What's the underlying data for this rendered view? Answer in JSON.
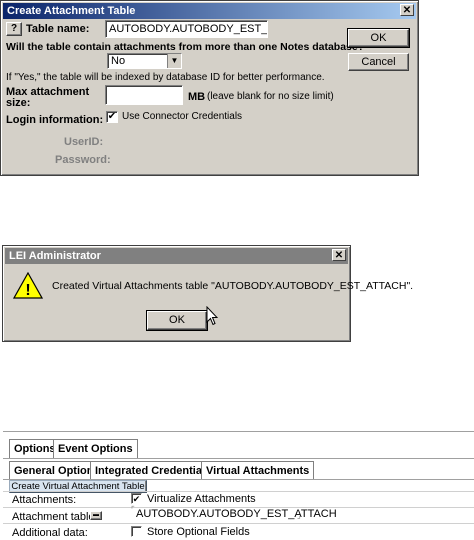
{
  "dialog1": {
    "title": "Create Attachment Table",
    "help_glyph": "?",
    "table_name_label": "Table name:",
    "table_name_value": "AUTOBODY.AUTOBODY_EST_ATTACH",
    "question": "Will the table contain attachments from more than one Notes database?",
    "dropdown_value": "No",
    "note": "If \"Yes,\" the table will be indexed by database ID for better performance.",
    "max_size_label_1": "Max attachment",
    "max_size_label_2": "size:",
    "max_size_value": "",
    "mb_label": "MB",
    "mb_hint": "(leave blank for no size limit)",
    "login_label": "Login information:",
    "connector_label": "Use Connector Credentials",
    "connector_checked": true,
    "userid_label": "UserID:",
    "password_label": "Password:",
    "ok_label": "OK",
    "cancel_label": "Cancel"
  },
  "dialog2": {
    "title": "LEI Administrator",
    "message": "Created Virtual Attachments table \"AUTOBODY.AUTOBODY_EST_ATTACH\".",
    "ok_label": "OK",
    "warning_glyph": "!"
  },
  "panel": {
    "tabs_top": [
      "Options",
      "Event Options"
    ],
    "tabs_second": [
      "General Options",
      "Integrated Credentials",
      "Virtual Attachments"
    ],
    "action_button": "Create Virtual Attachment Table",
    "attachments_label": "Attachments:",
    "virtualize_label": "Virtualize Attachments",
    "virtualize_checked": true,
    "attachment_table_label": "Attachment table:",
    "attachment_table_value": "AUTOBODY.AUTOBODY_EST_ATTACH",
    "additional_data_label": "Additional data:",
    "store_optional_label": "Store Optional Fields",
    "store_optional_checked": false
  },
  "colors": {
    "title_active": "#0a246a",
    "title_inactive": "#808080",
    "dialog_face": "#d4d0c8",
    "warning_yellow": "#ffff00"
  }
}
